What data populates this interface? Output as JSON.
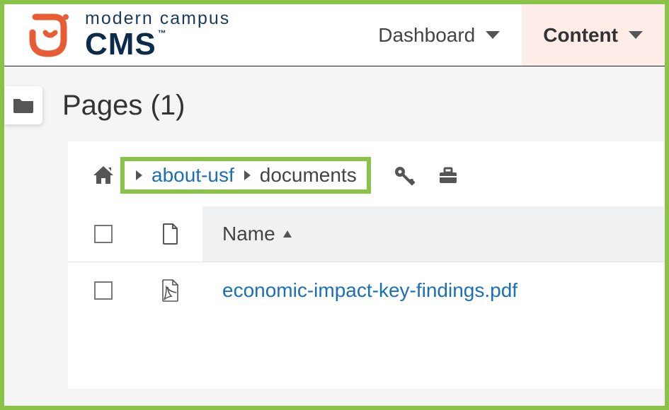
{
  "brand": {
    "line1": "modern campus",
    "line2": "CMS",
    "tm": "™"
  },
  "nav": {
    "dashboard": "Dashboard",
    "content": "Content"
  },
  "page": {
    "title": "Pages (1)"
  },
  "breadcrumb": {
    "items": [
      {
        "label": "about-usf",
        "link": true
      },
      {
        "label": "documents",
        "link": false
      }
    ]
  },
  "table": {
    "columns": {
      "name": "Name"
    },
    "rows": [
      {
        "filename": "economic-impact-key-findings.pdf",
        "type": "pdf"
      }
    ]
  }
}
